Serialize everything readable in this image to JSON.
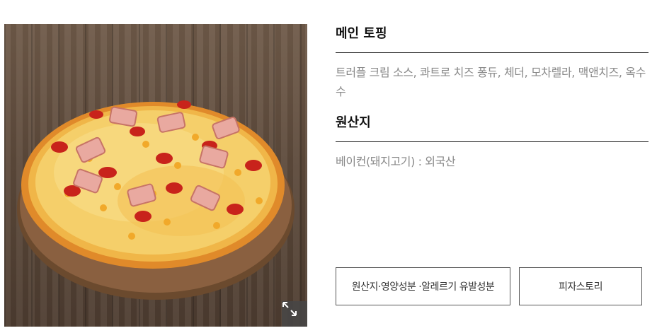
{
  "product": {
    "image_alt": "피자 이미지",
    "zoom_icon": "expand-icon"
  },
  "sections": {
    "main_topping": {
      "title": "메인 토핑",
      "text": "트러플 크림 소스, 콰트로 치즈 퐁듀, 체더, 모차렐라, 맥앤치즈, 옥수수"
    },
    "origin": {
      "title": "원산지",
      "text": "베이컨(돼지고기) : 외국산"
    }
  },
  "buttons": {
    "origin_nutrition_allergy": "원산지·영양성분 ·알레르기 유발성분",
    "pizza_story": "피자스토리"
  },
  "colors": {
    "heading": "#111111",
    "body_text": "#8a8a8a",
    "divider": "#222222",
    "button_border": "#555555"
  }
}
